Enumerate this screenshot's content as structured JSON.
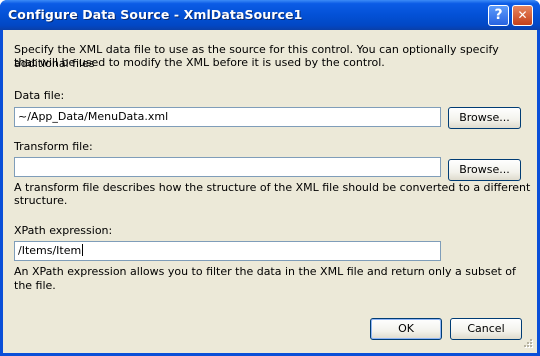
{
  "window": {
    "title": "Configure Data Source - XmlDataSource1",
    "help_label": "?",
    "close_label": "✕"
  },
  "intro": {
    "line1": "Specify the XML data file to use as the source for this control. You can optionally specify additional files",
    "line2": "that will be used to modify the XML before it is used by the control."
  },
  "data_file": {
    "label": "Data file:",
    "value": "~/App_Data/MenuData.xml",
    "browse_label": "Browse..."
  },
  "transform_file": {
    "label": "Transform file:",
    "value": "",
    "browse_label": "Browse...",
    "help_line1": "A transform file describes how the structure of the XML file should be converted to a different",
    "help_line2": "structure."
  },
  "xpath": {
    "label": "XPath expression:",
    "value": "/Items/Item",
    "help": "An XPath expression allows you to filter the data in the XML file and return only a subset of the file."
  },
  "footer": {
    "ok_label": "OK",
    "cancel_label": "Cancel"
  }
}
